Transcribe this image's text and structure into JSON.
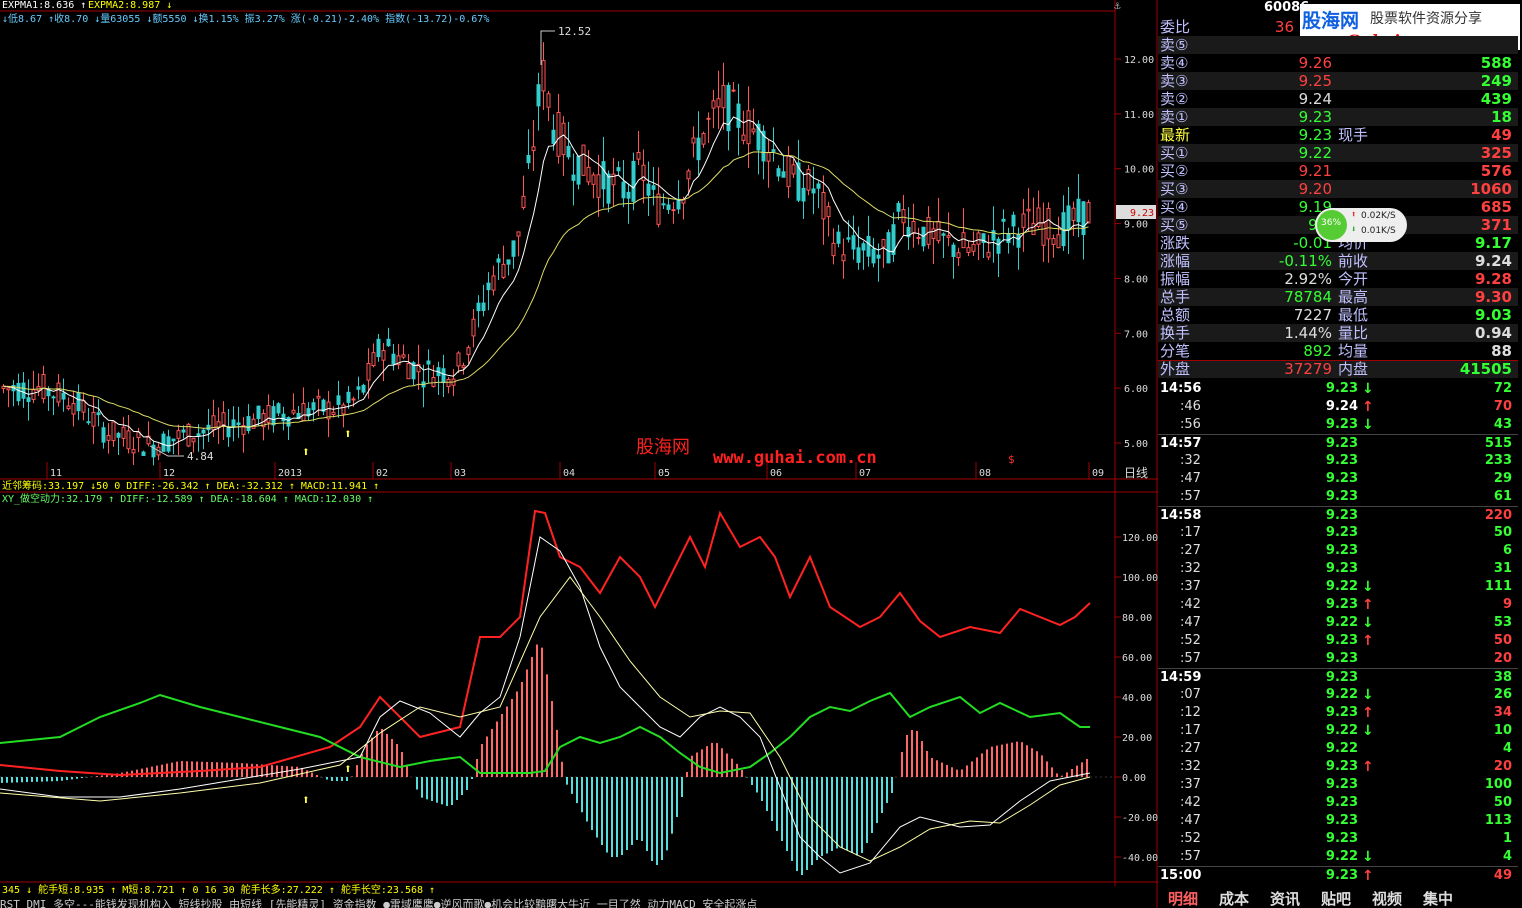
{
  "header": {
    "line1": "↓低8.67 ↑收8.70 ↓量63055 ↓额5550 ↓换1.15% 振3.27% 涨(-0.21)-2.40% 指数(-13.72)-0.67%",
    "expma1": "EXPMA1:8.636 ↑",
    "expma2": "EXPMA2:8.987 ↓",
    "stock_code": "60086",
    "logo_title": "股海网",
    "logo_sub": "股票软件资源分享",
    "logo_url": "www.Guhai.com.cn",
    "watermark_cn": "股海网",
    "watermark_url": "www.guhai.com.cn"
  },
  "price_chart": {
    "yticks": [
      "12.00",
      "11.00",
      "10.00",
      "9.00",
      "8.00",
      "7.00",
      "6.00",
      "5.00"
    ],
    "high_label": "12.52",
    "low_label": "4.84",
    "current_tag": "9.23",
    "xlabels": [
      "11",
      "12",
      "2013",
      "02",
      "03",
      "04",
      "05",
      "06",
      "07",
      "08",
      "09"
    ],
    "period": "日线",
    "s_marker": "$",
    "colors": {
      "up": "#ff5555",
      "down": "#33cccc",
      "ma_short": "#ffffff",
      "ma_long": "#dddd66"
    }
  },
  "indicator": {
    "row1": "近邻筹码:33.197 ↓50 0  DIFF:-26.342 ↑ DEA:-32.312 ↑ MACD:11.941 ↑",
    "row2": "XY_做空动力:32.179 ↑ DIFF:-12.589 ↑ DEA:-18.604 ↑ MACD:12.030 ↑",
    "yticks": [
      "120.00",
      "100.00",
      "80.00",
      "60.00",
      "40.00",
      "20.00",
      "0.00",
      "-20.00",
      "-40.00"
    ]
  },
  "bottom": {
    "line1": "345 ↓ 舵手短:8.935 ↑ M短:8.721 ↑ 0  16  30  舵手长多:27.222 ↑ 舵手长空:23.568 ↑",
    "line2": "RST    DMI    多空---能钱发现机构入  短线抄股  由短线  [先能精灵] 资金指数 ●雷域鹰鹰●逆风而歌●机会比较黯曙大牛近  一目了然  动力MACD  安全起涨点"
  },
  "quote": {
    "weibi_label": "委比",
    "weibi_value": "36",
    "rows": [
      {
        "label": "卖⑤",
        "price": "",
        "vol": ""
      },
      {
        "label": "卖④",
        "price": "9.26",
        "vol": "588"
      },
      {
        "label": "卖③",
        "price": "9.25",
        "vol": "249"
      },
      {
        "label": "卖②",
        "price": "9.24",
        "vol": "439"
      },
      {
        "label": "卖①",
        "price": "9.23",
        "vol": "18"
      },
      {
        "label": "最新",
        "price": "9.23",
        "vol": "49",
        "label2": "现手"
      },
      {
        "label": "买①",
        "price": "9.22",
        "vol": "325"
      },
      {
        "label": "买②",
        "price": "9.21",
        "vol": "576"
      },
      {
        "label": "买③",
        "price": "9.20",
        "vol": "1060"
      },
      {
        "label": "买④",
        "price": "9.19",
        "vol": "685"
      },
      {
        "label": "买⑤",
        "price": "9.0",
        "vol": "371"
      },
      {
        "label": "涨跌",
        "price": "-0.01",
        "vol": "9.17",
        "label2": "均价"
      },
      {
        "label": "涨幅",
        "price": "-0.11%",
        "vol": "9.24",
        "label2": "前收"
      },
      {
        "label": "振幅",
        "price": "2.92%",
        "vol": "9.28",
        "label2": "今开"
      },
      {
        "label": "总手",
        "price": "78784",
        "vol": "9.30",
        "label2": "最高"
      },
      {
        "label": "总额",
        "price": "7227",
        "vol": "9.03",
        "label2": "最低"
      },
      {
        "label": "换手",
        "price": "1.44%",
        "vol": "0.94",
        "label2": "量比"
      },
      {
        "label": "分笔",
        "price": "892",
        "vol": "88",
        "label2": "均量"
      },
      {
        "label": "外盘",
        "price": "37279",
        "vol": "41505",
        "label2": "内盘"
      }
    ],
    "speed": {
      "pct": "36%",
      "up": "0.02K/S",
      "down": "0.01K/S"
    },
    "ticks": [
      {
        "t": "14:56",
        "p": "9.23",
        "a": "↓",
        "v": "72"
      },
      {
        "t": ":46",
        "p": "9.24",
        "a": "↑",
        "v": "70"
      },
      {
        "t": ":56",
        "p": "9.23",
        "a": "↓",
        "v": "43"
      },
      {
        "t": "14:57",
        "p": "9.23",
        "a": "",
        "v": "515"
      },
      {
        "t": ":32",
        "p": "9.23",
        "a": "",
        "v": "233"
      },
      {
        "t": ":47",
        "p": "9.23",
        "a": "",
        "v": "29"
      },
      {
        "t": ":57",
        "p": "9.23",
        "a": "",
        "v": "61"
      },
      {
        "t": "14:58",
        "p": "9.23",
        "a": "",
        "v": "220"
      },
      {
        "t": ":17",
        "p": "9.23",
        "a": "",
        "v": "50"
      },
      {
        "t": ":27",
        "p": "9.23",
        "a": "",
        "v": "6"
      },
      {
        "t": ":32",
        "p": "9.23",
        "a": "",
        "v": "31"
      },
      {
        "t": ":37",
        "p": "9.22",
        "a": "↓",
        "v": "111"
      },
      {
        "t": ":42",
        "p": "9.23",
        "a": "↑",
        "v": "9"
      },
      {
        "t": ":47",
        "p": "9.22",
        "a": "↓",
        "v": "53"
      },
      {
        "t": ":52",
        "p": "9.23",
        "a": "↑",
        "v": "50"
      },
      {
        "t": ":57",
        "p": "9.23",
        "a": "",
        "v": "20"
      },
      {
        "t": "14:59",
        "p": "9.23",
        "a": "",
        "v": "38"
      },
      {
        "t": ":07",
        "p": "9.22",
        "a": "↓",
        "v": "26"
      },
      {
        "t": ":12",
        "p": "9.23",
        "a": "↑",
        "v": "34"
      },
      {
        "t": ":17",
        "p": "9.22",
        "a": "↓",
        "v": "10"
      },
      {
        "t": ":27",
        "p": "9.22",
        "a": "",
        "v": "4"
      },
      {
        "t": ":32",
        "p": "9.23",
        "a": "↑",
        "v": "20"
      },
      {
        "t": ":37",
        "p": "9.23",
        "a": "",
        "v": "100"
      },
      {
        "t": ":42",
        "p": "9.23",
        "a": "",
        "v": "50"
      },
      {
        "t": ":47",
        "p": "9.23",
        "a": "",
        "v": "113"
      },
      {
        "t": ":52",
        "p": "9.23",
        "a": "",
        "v": "1"
      },
      {
        "t": ":57",
        "p": "9.22",
        "a": "↓",
        "v": "4"
      },
      {
        "t": "15:00",
        "p": "9.23",
        "a": "↑",
        "v": "49"
      }
    ],
    "tabs": [
      "明细",
      "成本",
      "资讯",
      "贴吧",
      "视频",
      "集中"
    ]
  }
}
